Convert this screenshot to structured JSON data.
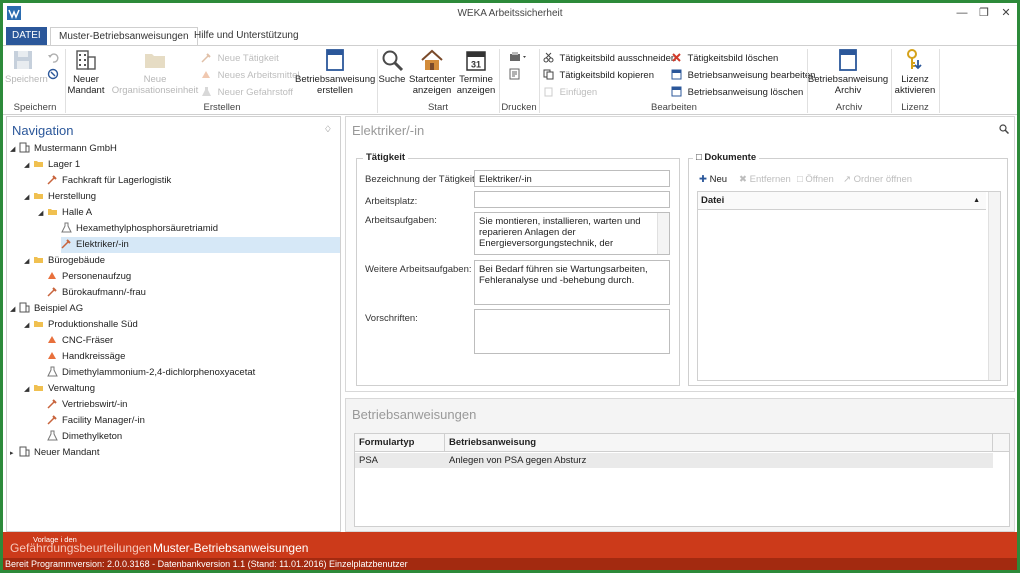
{
  "window": {
    "title": "WEKA Arbeitssicherheit"
  },
  "tabs": {
    "datei": "DATEI",
    "muster": "Muster-Betriebsanweisungen",
    "hilfe": "Hilfe und Unterstützung"
  },
  "ribbon": {
    "speichern_group": "Speichern",
    "erstellen_group": "Erstellen",
    "start_group": "Start",
    "drucken_group": "Drucken",
    "bearbeiten_group": "Bearbeiten",
    "archiv_group": "Archiv",
    "lizenz_group": "Lizenz",
    "speichern_label": "Speichern",
    "neuer_mandant": "Neuer Mandant",
    "neue_organisationseinheit": "Neue Organisationseinheit",
    "neue_taetigkeit": "Neue Tätigkeit",
    "neues_arbeitsmittel": "Neues Arbeitsmittel",
    "neuer_gefahrstoff": "Neuer Gefahrstoff",
    "ba_erstellen": "Betriebsanweisung erstellen",
    "suche": "Suche",
    "startcenter": "Startcenter anzeigen",
    "termine": "Termine anzeigen",
    "termine_icon_day": "31",
    "drucken": "Drucken",
    "ausschneiden": "Tätigkeitsbild ausschneiden",
    "kopieren": "Tätigkeitsbild kopieren",
    "einfuegen": "Einfügen",
    "loeschen_bild": "Tätigkeitsbild löschen",
    "ba_bearbeiten": "Betriebsanweisung bearbeiten",
    "ba_loeschen": "Betriebsanweisung löschen",
    "ba_archiv": "Betriebsanweisung Archiv",
    "lizenz": "Lizenz aktivieren"
  },
  "nav": {
    "title": "Navigation",
    "items": [
      {
        "label": "Mustermann GmbH",
        "icon": "building-icon",
        "expand": "open"
      },
      {
        "label": "Lager 1",
        "icon": "folder-icon",
        "expand": "open"
      },
      {
        "label": "Fachkraft für Lagerlogistik",
        "icon": "tool-icon",
        "expand": ""
      },
      {
        "label": "Herstellung",
        "icon": "folder-icon",
        "expand": "open"
      },
      {
        "label": "Halle A",
        "icon": "folder-icon",
        "expand": "open"
      },
      {
        "label": "Hexamethylphosphorsäuretriamid",
        "icon": "flask-icon",
        "expand": ""
      },
      {
        "label": "Elektriker/-in",
        "icon": "tool-icon",
        "expand": ""
      },
      {
        "label": "Bürogebäude",
        "icon": "folder-icon",
        "expand": "open"
      },
      {
        "label": "Personenaufzug",
        "icon": "machine-icon",
        "expand": ""
      },
      {
        "label": "Bürokaufmann/-frau",
        "icon": "tool-icon",
        "expand": ""
      },
      {
        "label": "Beispiel AG",
        "icon": "building-icon",
        "expand": "open"
      },
      {
        "label": "Produktionshalle Süd",
        "icon": "folder-icon",
        "expand": "open"
      },
      {
        "label": "CNC-Fräser",
        "icon": "machine-icon",
        "expand": ""
      },
      {
        "label": "Handkreissäge",
        "icon": "machine-icon",
        "expand": ""
      },
      {
        "label": "Dimethylammonium-2,4-dichlorphenoxyacetat",
        "icon": "flask-icon",
        "expand": ""
      },
      {
        "label": "Verwaltung",
        "icon": "folder-icon",
        "expand": "open"
      },
      {
        "label": "Vertriebswirt/-in",
        "icon": "tool-icon",
        "expand": ""
      },
      {
        "label": "Facility Manager/-in",
        "icon": "tool-icon",
        "expand": ""
      },
      {
        "label": "Dimethylketon",
        "icon": "flask-icon",
        "expand": ""
      },
      {
        "label": "Neuer Mandant",
        "icon": "building-icon",
        "expand": "closed"
      }
    ]
  },
  "main": {
    "title": "Elektriker/-in",
    "taetigkeit": {
      "title": "Tätigkeit",
      "bezeichnung_label": "Bezeichnung der Tätigkeit:",
      "bezeichnung_value": "Elektriker/-in",
      "arbeitsplatz_label": "Arbeitsplatz:",
      "arbeitsplatz_value": "",
      "aufgaben_label": "Arbeitsaufgaben:",
      "aufgaben_value": "Sie montieren, installieren, warten und reparieren Anlagen der Energieversorgungstechnik, der",
      "weitere_label": "Weitere Arbeitsaufgaben:",
      "weitere_value": "Bei Bedarf führen sie Wartungsarbeiten, Fehleranalyse und -behebung durch.",
      "vorschriften_label": "Vorschriften:",
      "vorschriften_value": ""
    },
    "dokumente": {
      "title": "Dokumente",
      "neu": "Neu",
      "entfernen": "Entfernen",
      "oeffnen": "Öffnen",
      "ordner": "Ordner öffnen",
      "col_datei": "Datei"
    }
  },
  "ba": {
    "title": "Betriebsanweisungen",
    "col_formulartyp": "Formulartyp",
    "col_ba": "Betriebsanweisung",
    "rows": [
      {
        "typ": "PSA",
        "name": "Anlegen von PSA gegen Absturz"
      }
    ]
  },
  "module": {
    "small": "Vorlage i den",
    "gefaehrdung": "Gefährdungsbeurteilungen",
    "muster": "Muster-Betriebsanweisungen"
  },
  "status": {
    "text": "Bereit   Programmversion: 2.0.0.3168 - Datenbankversion 1.1 (Stand: 11.01.2016)   Einzelplatzbenutzer"
  },
  "colors": {
    "accent": "#2b579a",
    "module_bar": "#cc3a1a",
    "status_bar": "#a32a10",
    "frame": "#2d8a3a"
  }
}
